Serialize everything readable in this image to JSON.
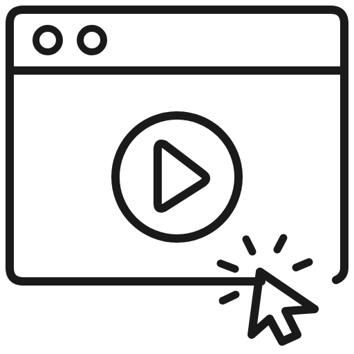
{
  "icon": {
    "name": "video-player-click",
    "stroke_color": "#1a1a1a",
    "background_color": "#ffffff",
    "parts": {
      "window": "browser-window-icon",
      "window_dots": "window-control-dots-icon",
      "play": "play-button-icon",
      "cursor": "mouse-pointer-icon",
      "click_rays": "click-burst-icon"
    }
  }
}
